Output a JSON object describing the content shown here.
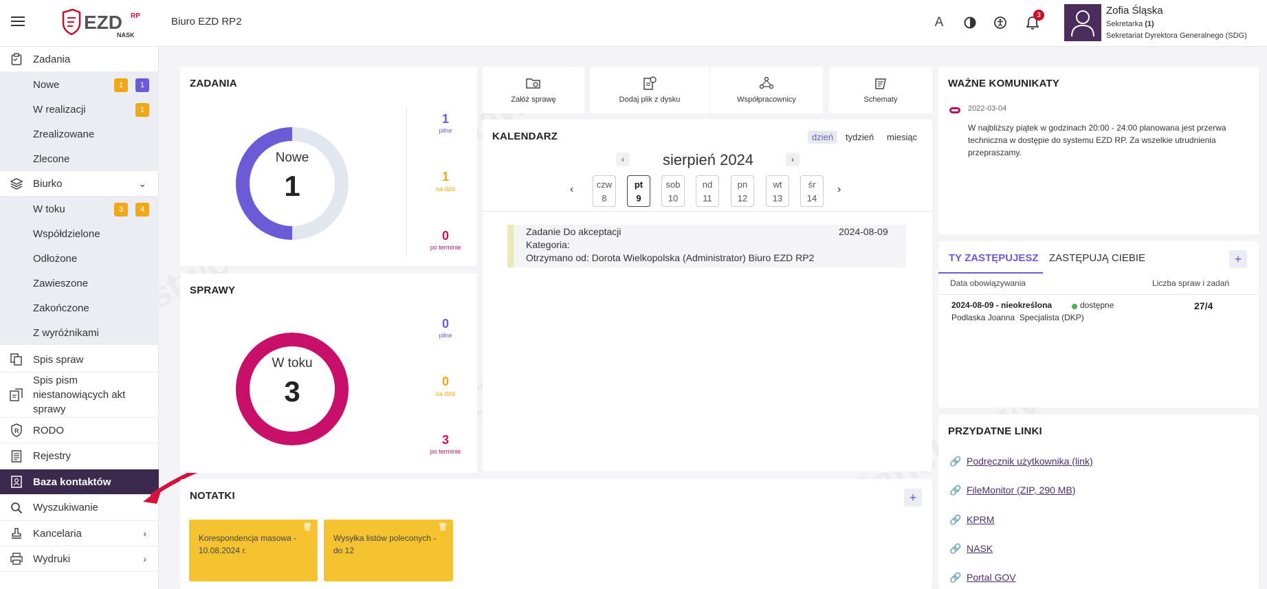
{
  "header": {
    "logo_text": "EZD",
    "logo_sup": "RP",
    "logo_sub": "NASK",
    "office_name": "Biuro EZD RP2",
    "notifications_count": "3",
    "user": {
      "name": "Zofia Śląska",
      "role_prefix": "Sekretarka",
      "role_count": "(1)",
      "department": "Sekretariat Dyrektora Generalnego (SDG)"
    }
  },
  "sidebar": {
    "zadania": "Zadania",
    "zadania_sub": [
      {
        "label": "Nowe",
        "badge1": "1",
        "badge2": "1"
      },
      {
        "label": "W realizacji",
        "badge1": "1"
      },
      {
        "label": "Zrealizowane"
      },
      {
        "label": "Zlecone"
      }
    ],
    "biurko": "Biurko",
    "biurko_sub": [
      {
        "label": "W toku",
        "badge1": "3",
        "badge2": "4"
      },
      {
        "label": "Współdzielone"
      },
      {
        "label": "Odłożone"
      },
      {
        "label": "Zawieszone"
      },
      {
        "label": "Zakończone"
      },
      {
        "label": "Z wyróżnikami"
      }
    ],
    "spis_spraw": "Spis spraw",
    "spis_pism": "Spis pism niestanowiących akt sprawy",
    "rodo": "RODO",
    "rejestry": "Rejestry",
    "baza_kontaktow": "Baza kontaktów",
    "wyszukiwanie": "Wyszukiwanie",
    "kancelaria": "Kancelaria",
    "wydruki": "Wydruki"
  },
  "zadania_card": {
    "title": "ZADANIA",
    "donut_label": "Nowe",
    "donut_value": "1",
    "stats": [
      {
        "num": "1",
        "label": "pilne"
      },
      {
        "num": "1",
        "label": "na dziś"
      },
      {
        "num": "0",
        "label": "po terminie"
      }
    ]
  },
  "sprawy_card": {
    "title": "SPRAWY",
    "donut_label": "W toku",
    "donut_value": "3",
    "stats": [
      {
        "num": "0",
        "label": "pilne"
      },
      {
        "num": "0",
        "label": "na dziś"
      },
      {
        "num": "3",
        "label": "po terminie"
      }
    ]
  },
  "actions": [
    {
      "label": "Załóż sprawę"
    },
    {
      "label": "Dodaj plik z dysku"
    },
    {
      "label": "Współpracownicy"
    },
    {
      "label": "Schematy"
    }
  ],
  "kalendarz": {
    "title": "KALENDARZ",
    "views": [
      "dzień",
      "tydzień",
      "miesiąc"
    ],
    "month": "sierpień 2024",
    "days": [
      {
        "name": "czw",
        "num": "8"
      },
      {
        "name": "pt",
        "num": "9"
      },
      {
        "name": "sob",
        "num": "10"
      },
      {
        "name": "nd",
        "num": "11"
      },
      {
        "name": "pn",
        "num": "12"
      },
      {
        "name": "wt",
        "num": "13"
      },
      {
        "name": "śr",
        "num": "14"
      }
    ],
    "event": {
      "title": "Zadanie Do akceptacji",
      "date": "2024-08-09",
      "category": "Kategoria:",
      "received": "Otrzymano od: Dorota Wielkopolska (Administrator) Biuro EZD RP2"
    }
  },
  "notatki": {
    "title": "NOTATKI",
    "notes": [
      "Korespondencja masowa - 10.08.2024 r.",
      "Wysyłka listów poleconych - do 12"
    ]
  },
  "komunikaty": {
    "title": "WAŻNE KOMUNIKATY",
    "date": "2022-03-04",
    "text": "W najbliższy piątek w godzinach 20:00 - 24:00 planowana jest przerwa techniczna w dostępie do systemu EZD RP. Za wszelkie utrudnienia przepraszamy."
  },
  "zastepstwa": {
    "tab1": "TY ZASTĘPUJESZ",
    "tab2": "ZASTĘPUJĄ CIEBIE",
    "col1": "Data obowiązywania",
    "col2": "Liczba spraw i zadań",
    "row": {
      "dates": "2024-08-09 - nieokreślona",
      "status": "dostępne",
      "person": "Podlaska Joanna  Specjalista (DKP)",
      "count": "27/4"
    }
  },
  "linki": {
    "title": "PRZYDATNE LINKI",
    "items": [
      "Podręcznik użytkownika (link)",
      "FileMonitor (ZIP, 290 MB)",
      "KPRM",
      "NASK",
      "Portal GOV"
    ]
  },
  "colors": {
    "accent_purple": "#6b5bd6",
    "dark_purple": "#3c2a4e",
    "magenta": "#c8106a",
    "orange": "#f0a818",
    "note_yellow": "#f5c230"
  }
}
